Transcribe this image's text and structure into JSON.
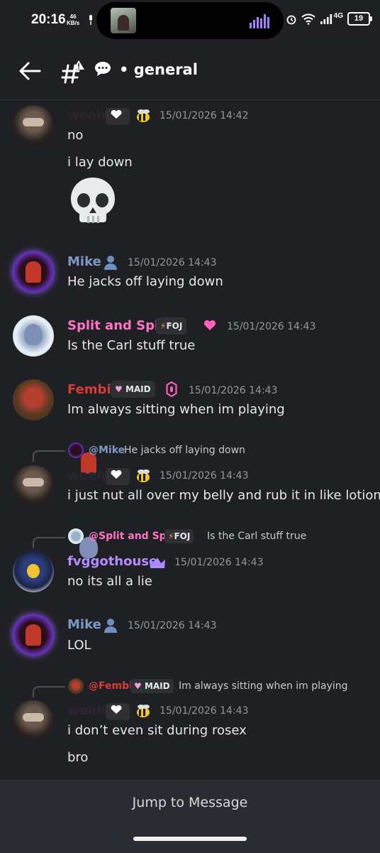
{
  "status_bar": {
    "time": "20:16",
    "speed_value": "46",
    "speed_unit": "KB/s",
    "network": "4G",
    "battery": "19"
  },
  "header": {
    "channel_name": "general",
    "channel_emoji": "speech-bubble-icon"
  },
  "messages": [
    {
      "author": "woah",
      "timestamp": "15/01/2026 14:42",
      "lines": [
        "no",
        "i lay down"
      ],
      "attachment_emoji": "skull"
    },
    {
      "author": "Mike",
      "timestamp": "15/01/2026 14:43",
      "lines": [
        "He jacks off laying down"
      ]
    },
    {
      "author": "Split and Spit",
      "tag": "FOJ",
      "timestamp": "15/01/2026 14:43",
      "lines": [
        "Is the Carl stuff true"
      ]
    },
    {
      "author": "Fembi",
      "tag": "MAID",
      "timestamp": "15/01/2026 14:43",
      "lines": [
        "Im always sitting when im playing"
      ]
    },
    {
      "reply": {
        "mention": "@Mike",
        "text": "He jacks off laying down"
      },
      "author": "woah",
      "timestamp": "15/01/2026 14:43",
      "lines": [
        "i just nut all over my belly and rub it in like lotion"
      ]
    },
    {
      "reply": {
        "mention": "@Split and Spit",
        "tag": "FOJ",
        "text": "Is the Carl stuff true"
      },
      "author": "fvggothouse",
      "timestamp": "15/01/2026 14:43",
      "lines": [
        "no its all a lie"
      ]
    },
    {
      "author": "Mike",
      "timestamp": "15/01/2026 14:43",
      "lines": [
        "LOL"
      ]
    },
    {
      "reply": {
        "mention": "@Fembi",
        "tag": "MAID",
        "text": "Im always sitting when im playing"
      },
      "author": "woah",
      "timestamp": "15/01/2026 14:43",
      "lines": [
        "i don’t even sit during rosex",
        "bro"
      ]
    }
  ],
  "colors": {
    "background": "#1f2024",
    "mike": "#7c98c4",
    "split": "#ff73c3",
    "fembi": "#d93b3b",
    "fvggothouse": "#b38cff",
    "woah": "#2a2530"
  },
  "jump_button": {
    "label": "Jump to Message"
  }
}
